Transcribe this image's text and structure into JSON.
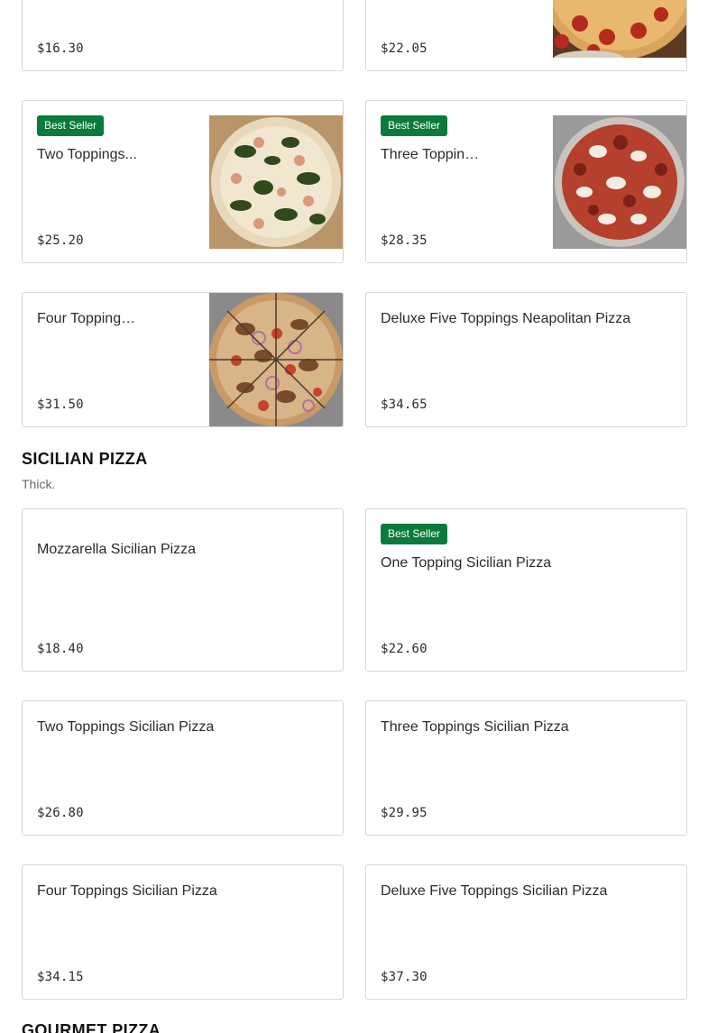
{
  "neapolitan": {
    "items": [
      {
        "price": "$16.30"
      },
      {
        "price": "$22.05",
        "image": "pepperoni-pizza-photo"
      },
      {
        "badge": "Best Seller",
        "name": "Two Toppings...",
        "price": "$25.20",
        "image": "spinach-pizza-photo"
      },
      {
        "badge": "Best Seller",
        "name": "Three Toppings...",
        "price": "$28.35",
        "image": "meat-pizza-photo"
      },
      {
        "name": "Four Toppings...",
        "price": "$31.50",
        "image": "onion-pizza-photo"
      },
      {
        "name": "Deluxe Five Toppings Neapolitan Pizza",
        "price": "$34.65"
      }
    ]
  },
  "sicilian": {
    "title": "SICILIAN PIZZA",
    "subtitle": "Thick.",
    "items": [
      {
        "name": "Mozzarella Sicilian Pizza",
        "price": "$18.40"
      },
      {
        "badge": "Best Seller",
        "name": "One Topping Sicilian Pizza",
        "price": "$22.60"
      },
      {
        "name": "Two Toppings Sicilian Pizza",
        "price": "$26.80"
      },
      {
        "name": "Three Toppings Sicilian Pizza",
        "price": "$29.95"
      },
      {
        "name": "Four Toppings Sicilian Pizza",
        "price": "$34.15"
      },
      {
        "name": "Deluxe Five Toppings Sicilian Pizza",
        "price": "$37.30"
      }
    ]
  },
  "gourmet": {
    "title": "GOURMET PIZZA"
  },
  "colors": {
    "badge": "#0b7a3d",
    "border": "#d6d6d6"
  }
}
